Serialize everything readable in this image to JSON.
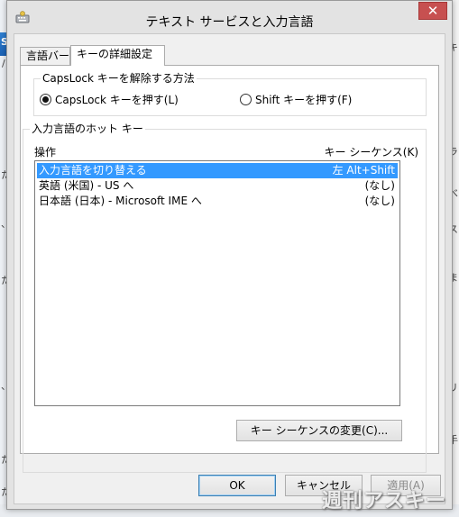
{
  "window": {
    "title": "テキスト サービスと入力言語",
    "close_glyph": "✕"
  },
  "tabs": [
    {
      "label": "言語バー"
    },
    {
      "label": "キーの詳細設定"
    }
  ],
  "capslock_group": {
    "label": "CapsLock キーを解除する方法",
    "options": [
      {
        "label": "CapsLock キーを押す(L)",
        "checked": true
      },
      {
        "label": "Shift キーを押す(F)",
        "checked": false
      }
    ]
  },
  "hotkey_group": {
    "label": "入力言語のホット キー",
    "columns": {
      "action": "操作",
      "sequence": "キー シーケンス(K)"
    },
    "rows": [
      {
        "action": "入力言語を切り替える",
        "sequence": "左 Alt+Shift",
        "selected": true
      },
      {
        "action": "英語 (米国) - US へ",
        "sequence": "(なし)",
        "selected": false
      },
      {
        "action": "日本語 (日本) - Microsoft IME へ",
        "sequence": "(なし)",
        "selected": false
      }
    ],
    "change_button": "キー シーケンスの変更(C)..."
  },
  "footer": {
    "ok": "OK",
    "cancel": "キャンセル",
    "apply": "適用(A)"
  },
  "watermark": "週刊アスキー",
  "background": {
    "glyphs": [
      "S",
      "/",
      "た",
      "、",
      "た",
      "、",
      "た",
      "た",
      "キ",
      "ラ",
      "べ",
      "ス",
      "ま",
      "リ",
      "手"
    ]
  },
  "colors": {
    "selection": "#3399ff",
    "close_button": "#c75050"
  }
}
